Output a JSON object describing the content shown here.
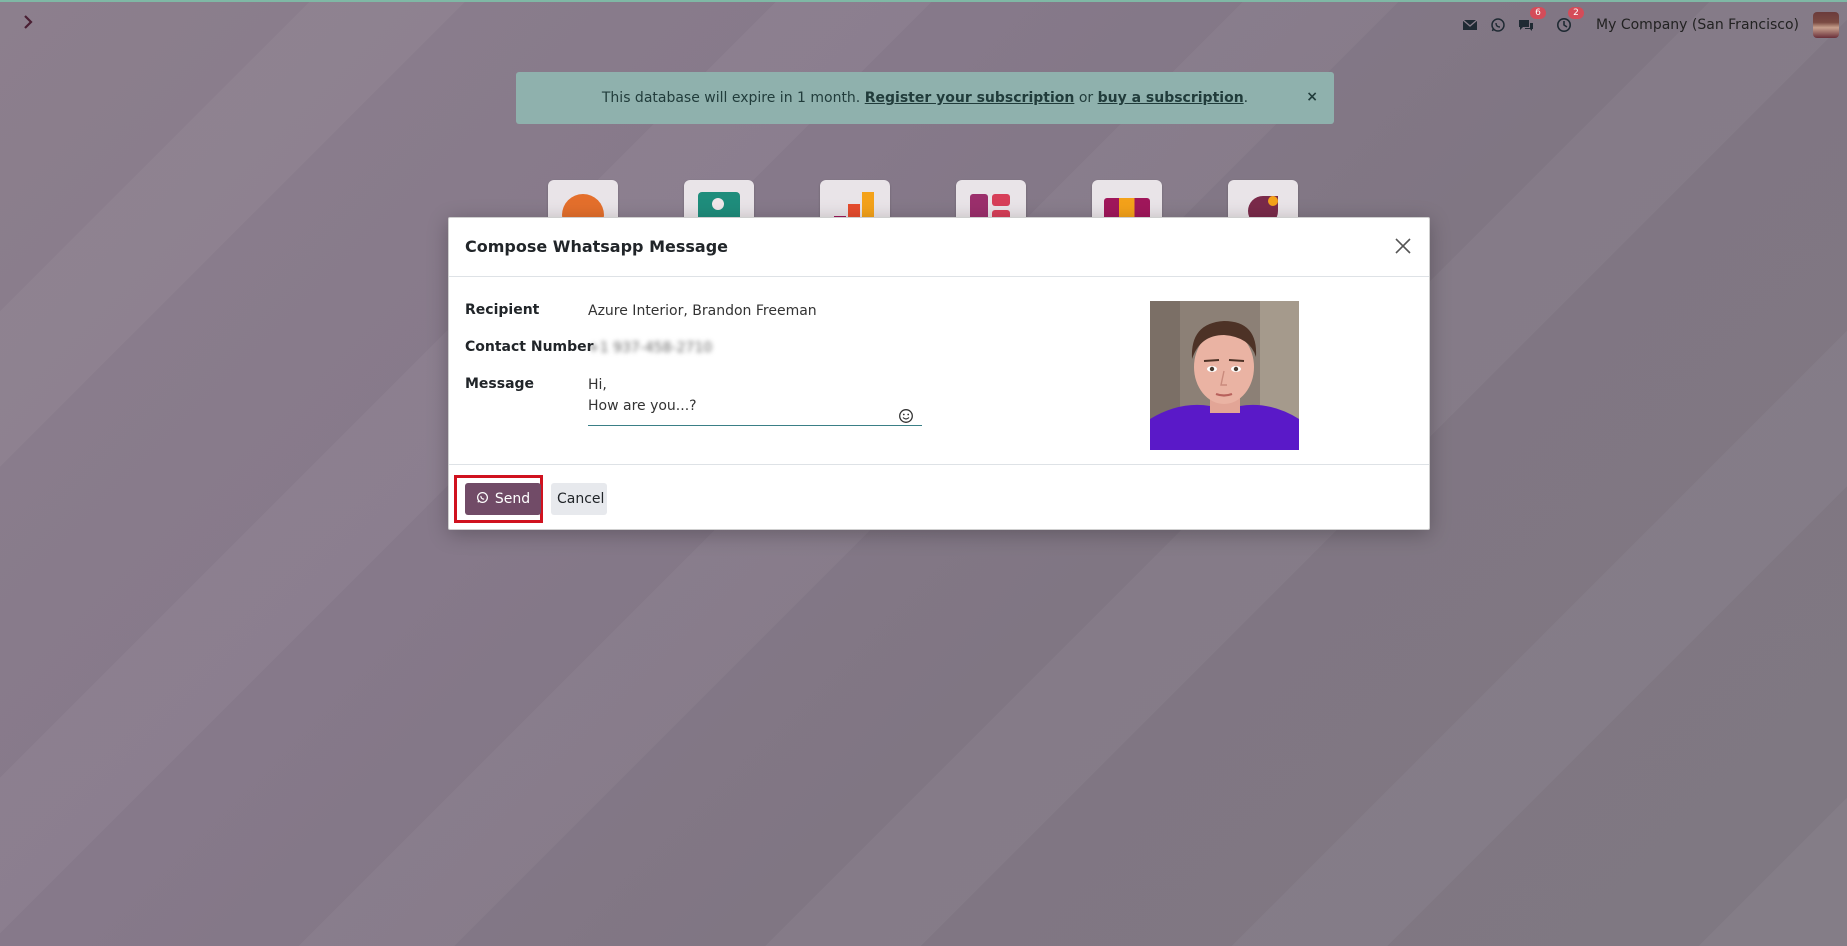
{
  "navbar": {
    "toggle_icon": "chevron-right-icon",
    "systray": {
      "mail_icon": "envelope-icon",
      "whatsapp_icon": "whatsapp-icon",
      "discuss_badge": "6",
      "activity_badge": "2",
      "company_name": "My Company (San Francisco)"
    }
  },
  "banner": {
    "text_prefix": "This database will expire in 1 month.",
    "register_link": "Register your subscription",
    "middle": "or",
    "buy_link": "buy a subscription",
    "suffix": ".",
    "close": "×",
    "color": "#8fb1ad"
  },
  "dialog": {
    "title": "Compose Whatsapp Message",
    "fields": {
      "recipient_label": "Recipient",
      "recipient_value": "Azure Interior, Brandon Freeman",
      "contact_label": "Contact Number",
      "contact_value": "+1 937-458-2710",
      "message_label": "Message",
      "message_value": "Hi,\nHow are you...?"
    },
    "footer": {
      "send_label": "Send",
      "cancel_label": "Cancel"
    }
  },
  "colors": {
    "primary": "#714b67",
    "highlight": "#d0121f",
    "badge": "#d44c59"
  }
}
